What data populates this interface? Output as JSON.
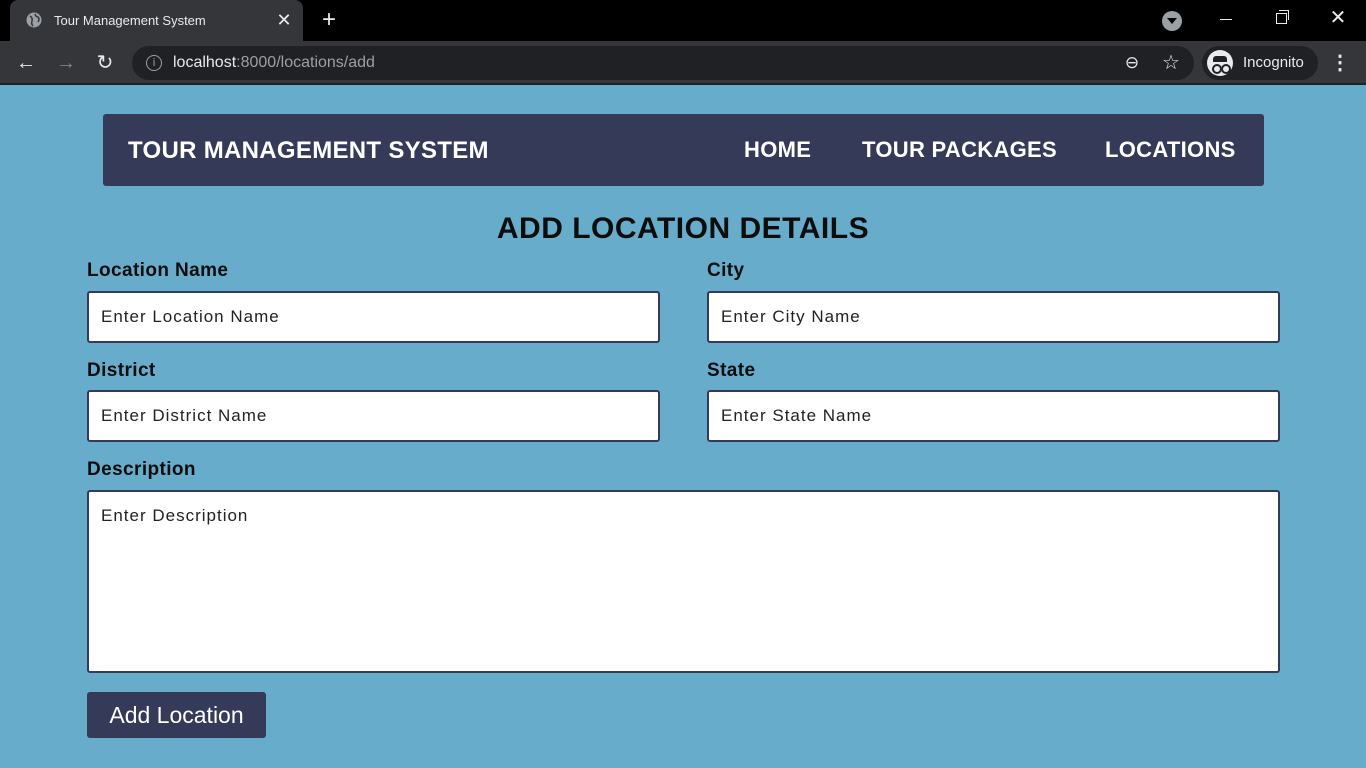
{
  "browser": {
    "tab_title": "Tour Management System",
    "url_host": "localhost",
    "url_path": ":8000/locations/add",
    "profile_label": "Incognito"
  },
  "navbar": {
    "brand": "TOUR MANAGEMENT SYSTEM",
    "links": [
      "HOME",
      "TOUR PACKAGES",
      "LOCATIONS"
    ]
  },
  "form": {
    "title": "ADD LOCATION DETAILS",
    "fields": {
      "location_name": {
        "label": "Location Name",
        "placeholder": "Enter Location Name",
        "value": ""
      },
      "city": {
        "label": "City",
        "placeholder": "Enter City Name",
        "value": ""
      },
      "district": {
        "label": "District",
        "placeholder": "Enter District Name",
        "value": ""
      },
      "state": {
        "label": "State",
        "placeholder": "Enter State Name",
        "value": ""
      },
      "description": {
        "label": "Description",
        "placeholder": "Enter Description",
        "value": ""
      }
    },
    "submit_label": "Add Location"
  },
  "icons": {
    "tab": "globe-icon",
    "close_tab": "close-icon",
    "new_tab": "plus-icon",
    "back": "arrow-left-icon",
    "forward": "arrow-right-icon",
    "reload": "reload-icon",
    "site_info": "info-icon",
    "zoom": "zoom-out-icon",
    "bookmark": "star-icon",
    "profile": "incognito-icon",
    "menu": "kebab-menu-icon"
  },
  "colors": {
    "page_background": "#67acca",
    "navbar": "#343a58",
    "button": "#343a58"
  }
}
